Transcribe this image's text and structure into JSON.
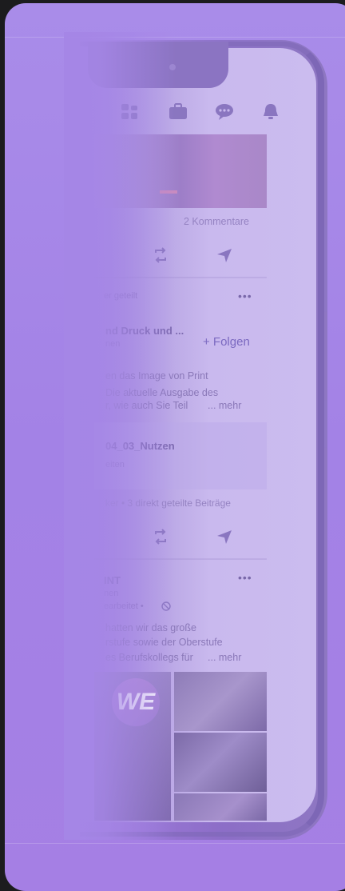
{
  "feed": {
    "post1": {
      "comments": "2 Kommentare"
    },
    "post2": {
      "shared_by": "er geteilt",
      "more_menu": "•••",
      "author_name": "nd Druck und ...",
      "author_sub": "nen",
      "follow_label": "+ Folgen",
      "body_line1": "en das Image von Print",
      "body_line2": "Die aktuelle Ausgabe des",
      "body_line3": "r, wie auch Sie Teil",
      "more_link": "... mehr",
      "attachment_title": "04_03_Nutzen",
      "attachment_sub": "eiten",
      "shares": "ker • 3 direkt geteilte Beiträge"
    },
    "post3": {
      "author_name": "INT",
      "author_line2": "nen",
      "author_line3": "earbeitet •",
      "more_menu": "•••",
      "body_line1": "hatten wir das große",
      "body_line2": "rstufe sowie der Oberstufe",
      "body_line3": "es Berufskollegs für",
      "more_link": "... mehr",
      "badge_text": "WE"
    }
  },
  "nav_icons": [
    "people-icon",
    "briefcase-icon",
    "chat-icon",
    "bell-icon"
  ],
  "colors": {
    "background": "#1c1c1e",
    "overlay": "#a586e6",
    "accent": "#7b69c0"
  }
}
